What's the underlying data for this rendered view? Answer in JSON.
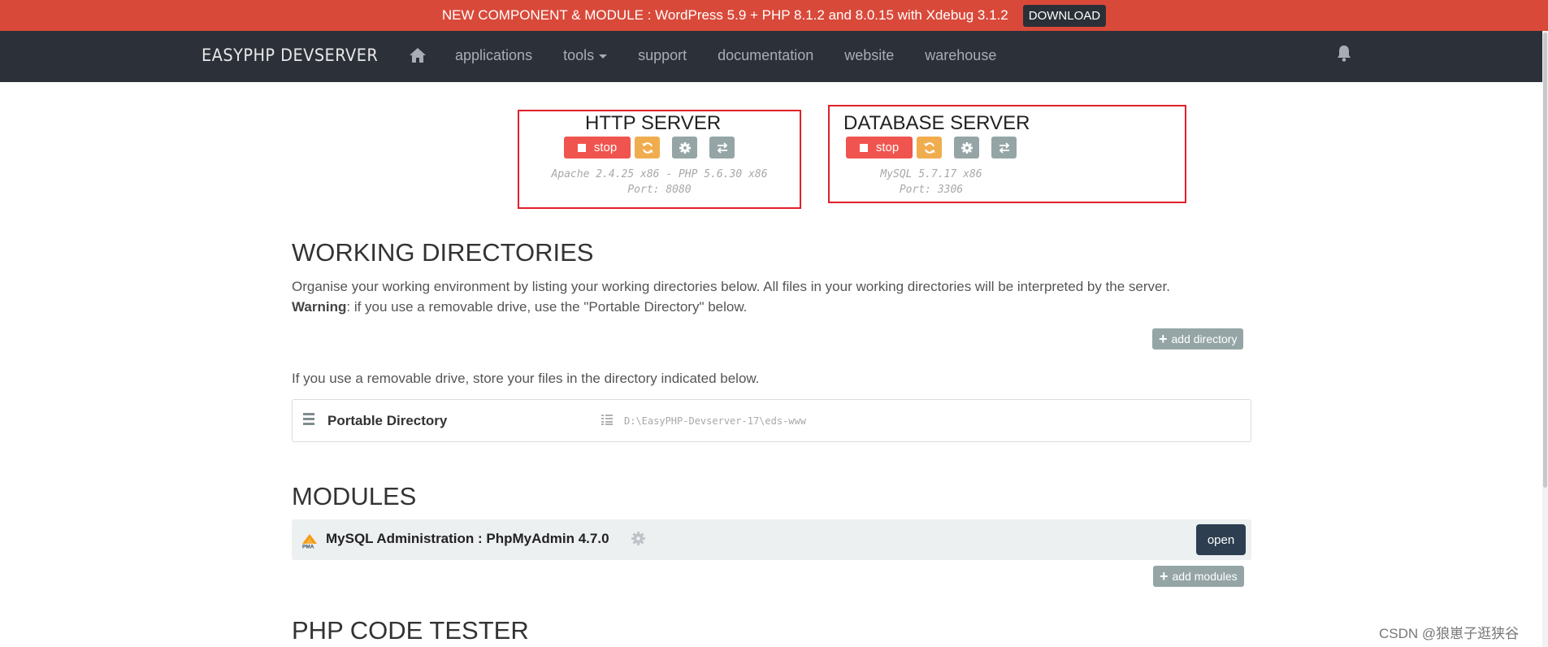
{
  "announcement": {
    "text": "NEW COMPONENT & MODULE : WordPress 5.9 + PHP 8.1.2 and 8.0.15 with Xdebug 3.1.2",
    "download_label": "DOWNLOAD"
  },
  "navbar": {
    "brand": "EASYPHP DEVSERVER",
    "items": [
      "applications",
      "tools",
      "support",
      "documentation",
      "website",
      "warehouse"
    ]
  },
  "http_server": {
    "title": "HTTP SERVER",
    "stop_label": "stop",
    "info_line1": "Apache 2.4.25 x86 - PHP 5.6.30 x86",
    "info_line2": "Port: 8080"
  },
  "database_server": {
    "title": "DATABASE SERVER",
    "stop_label": "stop",
    "info_line1": "MySQL 5.7.17 x86",
    "info_line2": "Port: 3306"
  },
  "working_directories": {
    "title": "WORKING DIRECTORIES",
    "description": "Organise your working environment by listing your working directories below. All files in your working directories will be interpreted by the server.",
    "warning_label": "Warning",
    "warning_text": ": if you use a removable drive, use the \"Portable Directory\" below.",
    "add_directory_label": "add directory",
    "removable_note": "If you use a removable drive, store your files in the directory indicated below.",
    "portable_label": "Portable Directory",
    "portable_path": "D:\\EasyPHP-Devserver-17\\eds-www"
  },
  "modules": {
    "title": "MODULES",
    "items": [
      {
        "label": "MySQL Administration : PhpMyAdmin 4.7.0",
        "open_label": "open"
      }
    ],
    "add_modules_label": "add modules"
  },
  "php_code_tester": {
    "title": "PHP CODE TESTER"
  },
  "watermark": "CSDN @狼崽子逛狭谷",
  "colors": {
    "announce_bg": "#d9493a",
    "navbar_bg": "#2c3039",
    "stop": "#f0544f",
    "reload": "#f0ad4e",
    "gray_button": "#95a5a6",
    "open_button": "#2c3e50",
    "highlight_border": "#e0202a"
  }
}
